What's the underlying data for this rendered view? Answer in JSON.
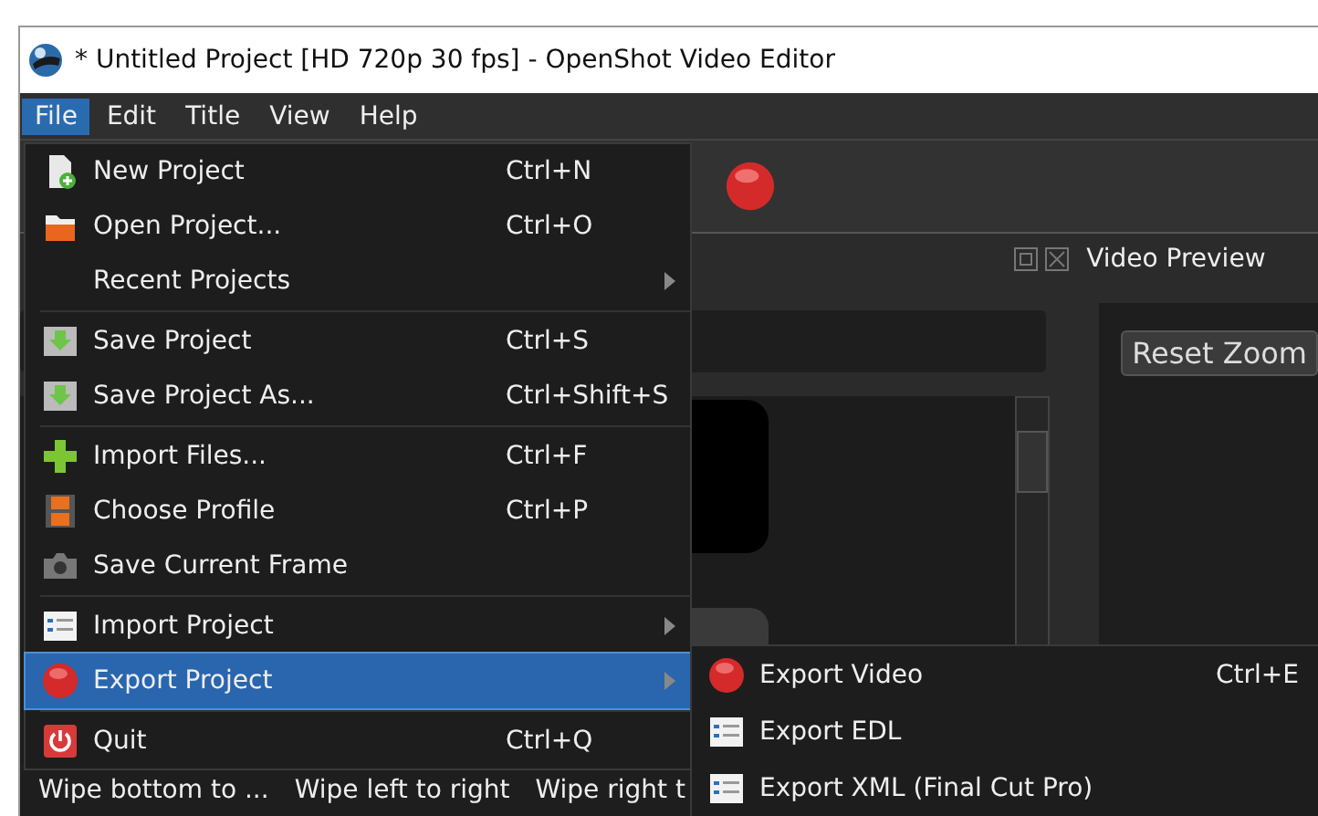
{
  "window": {
    "title": "* Untitled Project [HD 720p 30 fps] - OpenShot Video Editor"
  },
  "menu_bar": [
    {
      "label": "File",
      "selected": true
    },
    {
      "label": "Edit",
      "selected": false
    },
    {
      "label": "Title",
      "selected": false
    },
    {
      "label": "View",
      "selected": false
    },
    {
      "label": "Help",
      "selected": false
    }
  ],
  "file_menu": [
    {
      "kind": "item",
      "label": "New Project",
      "shortcut": "Ctrl+N",
      "submenu": false,
      "selected": false
    },
    {
      "kind": "item",
      "label": "Open Project...",
      "shortcut": "Ctrl+O",
      "submenu": false,
      "selected": false
    },
    {
      "kind": "item",
      "label": "Recent Projects",
      "submenu": true,
      "selected": false
    },
    {
      "kind": "separator"
    },
    {
      "kind": "item",
      "label": "Save Project",
      "shortcut": "Ctrl+S",
      "submenu": false,
      "selected": false
    },
    {
      "kind": "item",
      "label": "Save Project As...",
      "shortcut": "Ctrl+Shift+S",
      "submenu": false,
      "selected": false
    },
    {
      "kind": "separator"
    },
    {
      "kind": "item",
      "label": "Import Files...",
      "shortcut": "Ctrl+F",
      "submenu": false,
      "selected": false
    },
    {
      "kind": "item",
      "label": "Choose Profile",
      "shortcut": "Ctrl+P",
      "submenu": false,
      "selected": false
    },
    {
      "kind": "item",
      "label": "Save Current Frame",
      "submenu": false,
      "selected": false
    },
    {
      "kind": "separator"
    },
    {
      "kind": "item",
      "label": "Import Project",
      "submenu": true,
      "selected": false
    },
    {
      "kind": "item",
      "label": "Export Project",
      "submenu": true,
      "selected": true
    },
    {
      "kind": "separator"
    },
    {
      "kind": "item",
      "label": "Quit",
      "shortcut": "Ctrl+Q",
      "submenu": false,
      "selected": false
    }
  ],
  "export_submenu": [
    {
      "label": "Export Video",
      "shortcut": "Ctrl+E"
    },
    {
      "label": "Export EDL"
    },
    {
      "label": "Export XML (Final Cut Pro)"
    }
  ],
  "dock": {
    "title": "Video Preview"
  },
  "preview": {
    "button": "Reset Zoom"
  },
  "transitions": [
    "Wipe bottom to ...",
    "Wipe left to right",
    "Wipe right t"
  ]
}
